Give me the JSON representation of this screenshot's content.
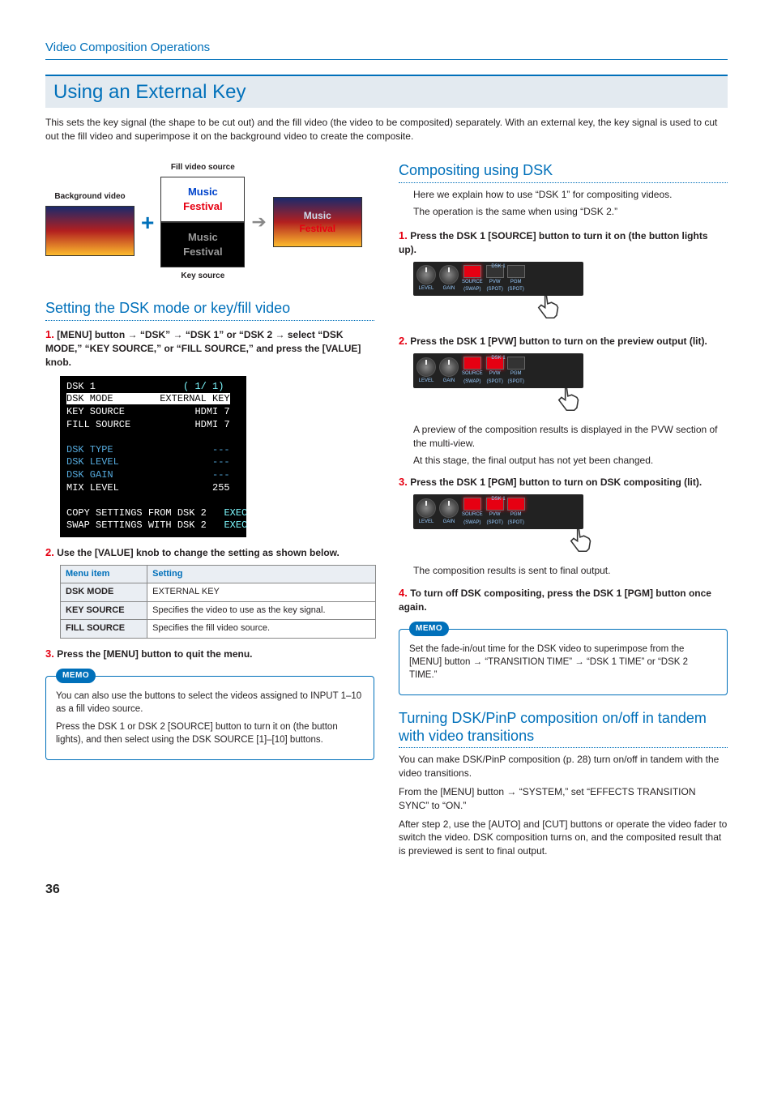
{
  "page": {
    "breadcrumb": "Video Composition Operations",
    "title": "Using an External Key",
    "intro": "This sets the key signal (the shape to be cut out) and the fill video (the video to be composited) separately. With an external key, the key signal is used to cut out the fill video and superimpose it on the background video to create the composite.",
    "number": "36"
  },
  "diagram": {
    "bg_label": "Background video",
    "fill_label": "Fill video source",
    "key_label": "Key source",
    "logo_line1": "Music",
    "logo_line2": "Festival"
  },
  "left": {
    "heading": "Setting the DSK mode or key/fill video",
    "step1_num": "1.",
    "step1_pre": "[MENU] button ",
    "step1_a": " “DSK” ",
    "step1_b": " “DSK 1” or “DSK 2 ",
    "step1_c": " select “DSK MODE,” “KEY SOURCE,” or “FILL SOURCE,” and press the [VALUE] knob.",
    "menu": {
      "title": "DSK 1",
      "page": "( 1/ 1)",
      "r1a": "DSK MODE",
      "r1b": "EXTERNAL KEY",
      "r2a": "KEY SOURCE",
      "r2b": "HDMI 7",
      "r3a": "FILL SOURCE",
      "r3b": "HDMI 7",
      "r4a": "DSK TYPE",
      "r4b": "---",
      "r5a": "DSK LEVEL",
      "r5b": "---",
      "r6a": "DSK GAIN",
      "r6b": "---",
      "r7a": "MIX LEVEL",
      "r7b": "255",
      "r8a": "COPY SETTINGS FROM DSK 2",
      "r8b": "EXEC",
      "r9a": "SWAP SETTINGS WITH DSK 2",
      "r9b": "EXEC"
    },
    "step2_num": "2.",
    "step2_text": "Use the [VALUE] knob to change the setting as shown below.",
    "table": {
      "h1": "Menu item",
      "h2": "Setting",
      "rows": [
        {
          "a": "DSK MODE",
          "b": "EXTERNAL KEY"
        },
        {
          "a": "KEY SOURCE",
          "b": "Specifies the video to use as the key signal."
        },
        {
          "a": "FILL SOURCE",
          "b": "Specifies the fill video source."
        }
      ]
    },
    "step3_num": "3.",
    "step3_text": "Press the [MENU] button to quit the menu.",
    "memo_badge": "MEMO",
    "memo_p1": "You can also use the buttons to select the videos assigned to INPUT 1–10 as a fill video source.",
    "memo_p2": "Press the DSK 1 or DSK 2 [SOURCE] button to turn it on (the button lights), and then select using the DSK SOURCE [1]–[10] buttons."
  },
  "right": {
    "heading": "Compositing using DSK",
    "intro1": "Here we explain how to use “DSK 1” for compositing videos.",
    "intro2": "The operation is the same when using “DSK 2.”",
    "step1_num": "1.",
    "step1_text": "Press the DSK 1 [SOURCE] button to turn it on (the button lights up).",
    "step2_num": "2.",
    "step2_text": "Press the DSK 1 [PVW] button to turn on the preview output (lit).",
    "step2_body1": "A preview of the composition results is displayed in the PVW section of the multi-view.",
    "step2_body2": "At this stage, the final output has not yet been changed.",
    "step3_num": "3.",
    "step3_text": "Press the DSK 1 [PGM] button to turn on DSK compositing (lit).",
    "step3_body": "The composition results is sent to final output.",
    "step4_num": "4.",
    "step4_text": "To turn off DSK compositing, press the DSK 1 [PGM] button once again.",
    "memo_badge": "MEMO",
    "memo_pre": "Set the fade-in/out time for the DSK video to superimpose from the [MENU] button ",
    "memo_a": " “TRANSITION TIME” ",
    "memo_b": " “DSK 1 TIME” or “DSK 2 TIME.”",
    "heading2": "Turning DSK/PinP composition on/off in tandem with video transitions",
    "p1": "You can make DSK/PinP composition (p. 28) turn on/off in tandem with the video transitions.",
    "p2a": "From the [MENU] button ",
    "p2b": " “SYSTEM,” set “EFFECTS TRANSITION SYNC” to “ON.”",
    "p3": "After step 2, use the [AUTO] and [CUT] buttons or operate the video fader to switch the video. DSK composition turns on, and the composited result that is previewed is sent to final output.",
    "panel_title": "DSK 1",
    "k_level": "LEVEL",
    "k_gain": "GAIN",
    "b_source": "SOURCE",
    "b_swap": "(SWAP)",
    "b_pvw": "PVW",
    "b_spot": "(SPOT)",
    "b_pgm": "PGM"
  }
}
